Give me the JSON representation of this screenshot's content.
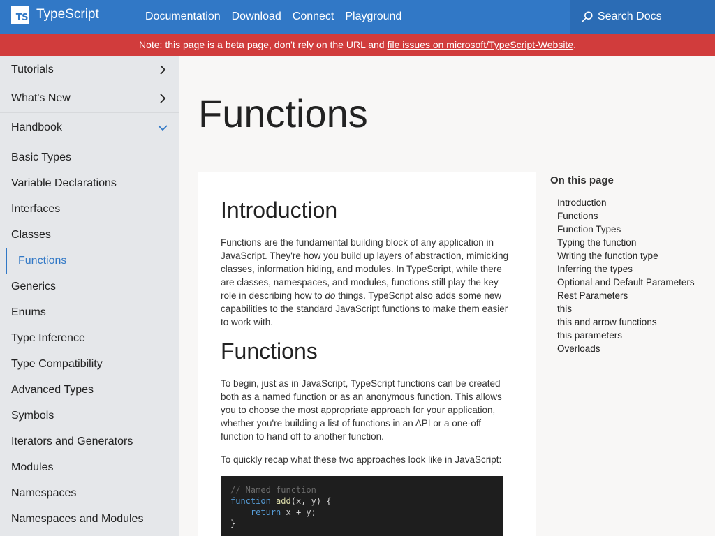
{
  "header": {
    "logo_text": "TypeScript",
    "logo_badge": "TS",
    "nav": [
      "Documentation",
      "Download",
      "Connect",
      "Playground"
    ],
    "search_placeholder": "Search Docs",
    "search_icon": "search-icon",
    "color_primary": "#3178c6"
  },
  "banner": {
    "text": "Note: this page is a beta page, don't rely on the URL and ",
    "link": "file issues on microsoft/TypeScript-Website",
    "suffix": ".",
    "color": "#d13c3c"
  },
  "sidebar": {
    "sections": [
      {
        "label": "Tutorials",
        "icon": "chevron-right-icon"
      },
      {
        "label": "What's New",
        "icon": "chevron-right-icon"
      },
      {
        "label": "Handbook",
        "icon": "chevron-down-icon"
      }
    ],
    "items": [
      "Basic Types",
      "Variable Declarations",
      "Interfaces",
      "Classes",
      "Functions",
      "Generics",
      "Enums",
      "Type Inference",
      "Type Compatibility",
      "Advanced Types",
      "Symbols",
      "Iterators and Generators",
      "Modules",
      "Namespaces",
      "Namespaces and Modules"
    ],
    "active_item": "Functions"
  },
  "main": {
    "title": "Functions",
    "sections": [
      {
        "heading": "Introduction",
        "para_before": "Functions are the fundamental building block of any application in JavaScript. They're how you build up layers of abstraction, mimicking classes, information hiding, and modules. In TypeScript, while there are classes, namespaces, and modules, functions still play the key role in describing how to ",
        "para_em": "do",
        "para_after": " things. TypeScript also adds some new capabilities to the standard JavaScript functions to make them easier to work with."
      },
      {
        "heading": "Functions",
        "para1": "To begin, just as in JavaScript, TypeScript functions can be created both as a named function or as an anonymous function. This allows you to choose the most appropriate approach for your application, whether you're building a list of functions in an API or a one-off function to hand off to another function.",
        "para2": "To quickly recap what these two approaches look like in JavaScript:"
      }
    ],
    "code": {
      "comment": "// Named function",
      "kw_function": "function",
      "fn_name": "add",
      "params": "(x, y) {",
      "kw_return": "return",
      "return_expr": " x + y;",
      "close": "}"
    }
  },
  "toc": {
    "heading": "On this page",
    "items": [
      "Introduction",
      "Functions",
      "Function Types",
      "Typing the function",
      "Writing the function type",
      "Inferring the types",
      "Optional and Default Parameters",
      "Rest Parameters",
      "this",
      "this and arrow functions",
      "this parameters",
      "Overloads"
    ]
  }
}
